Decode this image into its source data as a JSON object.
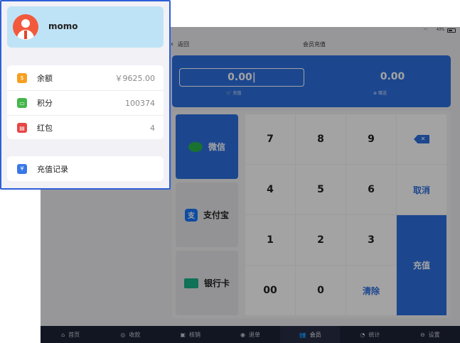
{
  "status_bar": {
    "battery_text": "43%"
  },
  "nav": {
    "back_label": "返回",
    "title": "会员充值"
  },
  "recharge": {
    "amount_value": "0.00",
    "amount_label": "充值",
    "gift_value": "0.00",
    "gift_label": "赠送"
  },
  "payment_methods": [
    {
      "label": "微信",
      "icon": "wechat-icon",
      "selected": true
    },
    {
      "label": "支付宝",
      "icon": "alipay-icon",
      "selected": false
    },
    {
      "label": "银行卡",
      "icon": "bank-card-icon",
      "selected": false
    }
  ],
  "keypad": {
    "k7": "7",
    "k8": "8",
    "k9": "9",
    "k4": "4",
    "k5": "5",
    "k6": "6",
    "k1": "1",
    "k2": "2",
    "k3": "3",
    "k00": "00",
    "k0": "0",
    "clear": "清除",
    "cancel": "取消",
    "charge": "充值"
  },
  "tabs": [
    {
      "label": "首页",
      "icon": "home-icon"
    },
    {
      "label": "收款",
      "icon": "cashier-icon"
    },
    {
      "label": "核销",
      "icon": "verify-icon"
    },
    {
      "label": "退单",
      "icon": "refund-icon"
    },
    {
      "label": "会员",
      "icon": "member-icon",
      "active": true
    },
    {
      "label": "统计",
      "icon": "stats-icon"
    },
    {
      "label": "设置",
      "icon": "settings-icon"
    }
  ],
  "member": {
    "name": "momo",
    "rows": [
      {
        "label": "余额",
        "value": "￥9625.00",
        "icon": "wallet-icon",
        "color": "#f5a020"
      },
      {
        "label": "积分",
        "value": "100374",
        "icon": "points-icon",
        "color": "#43b649"
      },
      {
        "label": "红包",
        "value": "4",
        "icon": "red-packet-icon",
        "color": "#e84545"
      }
    ],
    "record_label": "充值记录"
  },
  "colors": {
    "accent": "#2d6fe0",
    "popover_border": "#2d5fd8",
    "tab_bar": "#1d2336"
  }
}
